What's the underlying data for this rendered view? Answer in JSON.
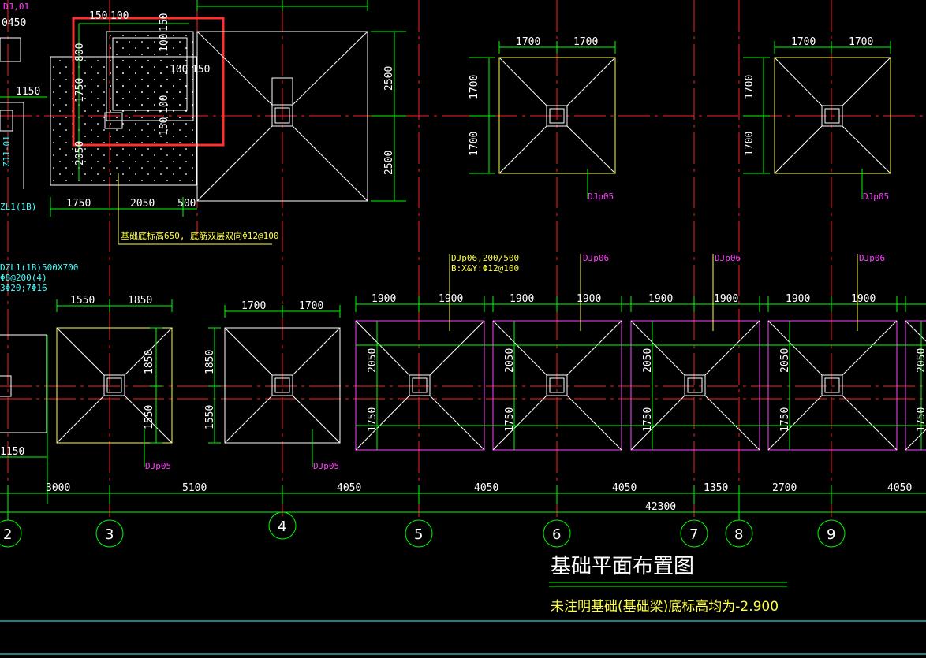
{
  "colors": {
    "background": "#000000",
    "axis_line": "#ff2020",
    "dimension": "#00ff00",
    "dimension_text": "#ffffff",
    "footing_yellow": "#ffff44",
    "footing_magenta": "#ff44ff",
    "footing_white": "#ffffff",
    "label_magenta": "#ff44ff",
    "label_cyan": "#44ffff",
    "highlight": "#ff3030",
    "frame_line": "#44ffff"
  },
  "drawing": {
    "title": "基础平面布置图",
    "note": "未注明基础(基础梁)底标高均为-2.900",
    "top_left_labels": {
      "dj01": "DJ,01",
      "v450": "0450",
      "zj01": "ZJJ-01",
      "zl1b": "ZL1(1B)"
    },
    "upper_dims": {
      "d150": "150",
      "d100": "100",
      "d800": "800",
      "d1750": "1750",
      "d2050": "2050",
      "d100b": "100",
      "d150b": "150",
      "d100c": "100",
      "d150c": "150",
      "d100d": "100",
      "d150d": "150",
      "d1150": "1150",
      "b1750": "1750",
      "b2050": "2050",
      "b500": "500",
      "r2500a": "2500",
      "r2500b": "2500",
      "f1_w1": "1700",
      "f1_w2": "1700",
      "f1_h1": "1700",
      "f1_h2": "1700",
      "f2_w1": "1700",
      "f2_w2": "1700",
      "f2_h1": "1700",
      "f2_h2": "1700"
    },
    "upper_labels": {
      "djp05_a": "DJp05",
      "djp05_b": "DJp05",
      "base_note": "基础底标高650, 底筋双层双向Φ12@100"
    },
    "beam_labels": {
      "dzl": "DZL1(1B)500X700",
      "stir": "Φ8@200(4)",
      "bars": "3Φ20;7Φ16"
    },
    "djp06_spec": {
      "line1": "DJp06,200/500",
      "line2": "B:X&Y:Φ12@100"
    },
    "lower_labels": {
      "djp06_a": "DJp06",
      "djp06_b": "DJp06",
      "djp06_c": "DJp06",
      "djp05_c": "DJp05",
      "djp05_d": "DJp05"
    },
    "lower_dims": {
      "a_w1": "1550",
      "a_w2": "1850",
      "a_h1": "1850",
      "a_h2": "1550",
      "b_w1": "1700",
      "b_w2": "1700",
      "b_h1": "1850",
      "b_h2": "1550",
      "m_w1": "1900",
      "m_w2": "1900",
      "m_h1": "2050",
      "m_h2": "1750",
      "left1150": "1150"
    },
    "axis_dims": {
      "s1": "3000",
      "s2": "5100",
      "s3": "4050",
      "s4": "4050",
      "s5": "4050",
      "s6": "1350",
      "s7": "2700",
      "s8": "4050",
      "total": "42300"
    },
    "axis_labels": {
      "a2": "2",
      "a3": "3",
      "a4": "4",
      "a5": "5",
      "a6": "6",
      "a7": "7",
      "a8": "8",
      "a9": "9"
    }
  }
}
